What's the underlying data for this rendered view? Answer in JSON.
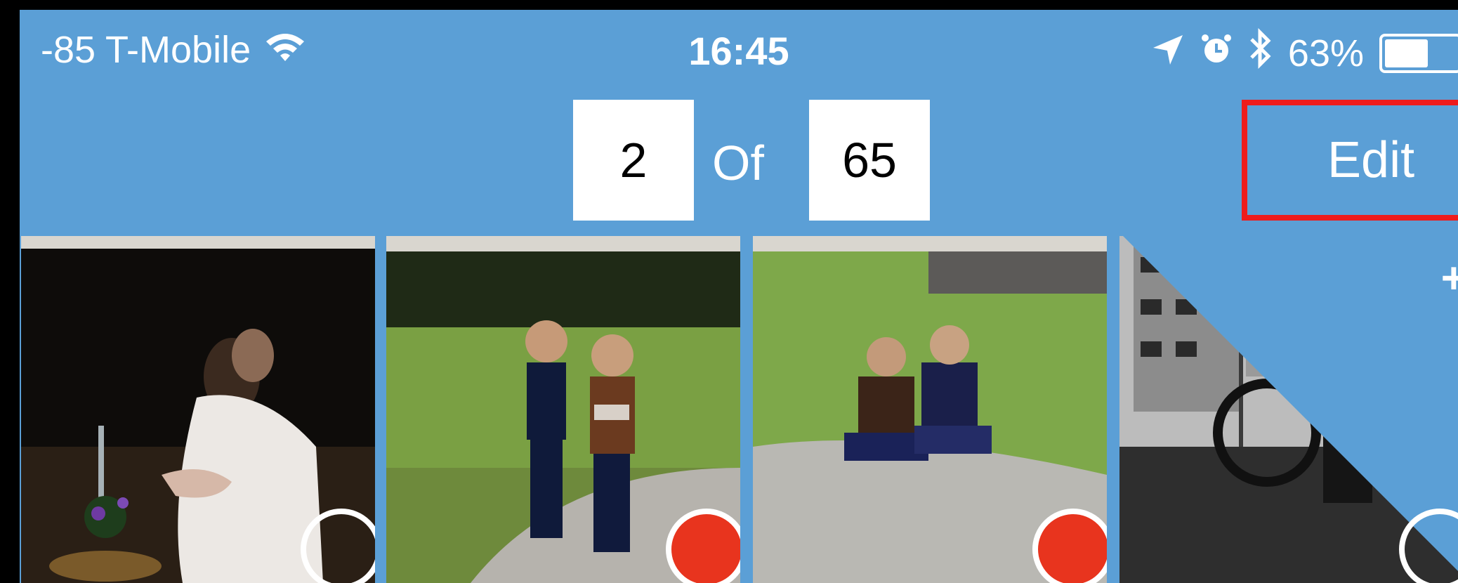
{
  "status": {
    "signal": "-85",
    "carrier": "T-Mobile",
    "time": "16:45",
    "battery_percent": "63%",
    "battery_level": 0.63,
    "icons": [
      "wifi-icon",
      "location-arrow-icon",
      "alarm-icon",
      "bluetooth-icon",
      "battery-icon"
    ]
  },
  "nav": {
    "current_index": "2",
    "of_label": "Of",
    "total": "65",
    "edit_label": "Edit"
  },
  "photos": [
    {
      "name": "photo-child-with-flowers",
      "selected": false
    },
    {
      "name": "photo-two-kids-standing",
      "selected": true
    },
    {
      "name": "photo-two-kids-sitting",
      "selected": true
    },
    {
      "name": "photo-woman-with-carts-bw",
      "selected": false
    }
  ],
  "add_button": {
    "label": "+"
  },
  "colors": {
    "background": "#5b9fd6",
    "edit_highlight": "#ee1c1c",
    "selected_dot": "#e8341e"
  }
}
